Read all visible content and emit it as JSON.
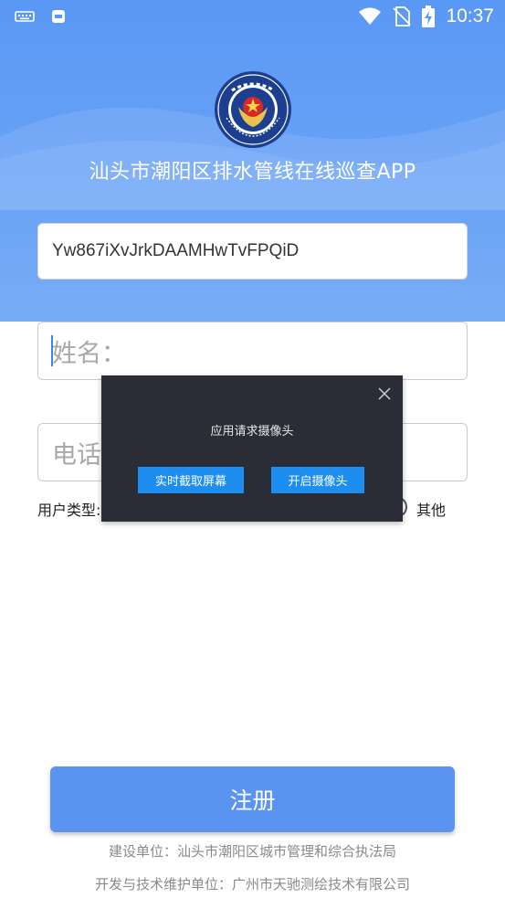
{
  "statusbar": {
    "time": "10:37",
    "icons": [
      "keyboard-icon",
      "notification-app-icon",
      "wifi-icon",
      "no-sim-icon",
      "battery-charging-icon"
    ]
  },
  "header": {
    "emblem": "city-management-law-enforcement-emblem",
    "app_title": "汕头市潮阳区排水管线在线巡查APP"
  },
  "form": {
    "device_id_value": "Yw867iXvJrkDAAMHwTvFPQiD",
    "name_placeholder": "姓名：",
    "phone_placeholder_visible": "电话",
    "user_type_label": "用户类型:",
    "user_type_option_visible": "其他"
  },
  "dialog": {
    "message": "应用请求摄像头",
    "screen_button": "实时截取屏幕",
    "camera_button": "开启摄像头"
  },
  "register_button": "注册",
  "footer": {
    "builder": "建设单位：汕头市潮阳区城市管理和综合执法局",
    "developer": "开发与技术维护单位：广州市天驰测绘技术有限公司"
  },
  "colors": {
    "header_blue": "#5a98f5",
    "button_blue": "#5b93f0",
    "dialog_bg": "#2a2d35",
    "dialog_button": "#1d8ef0"
  }
}
